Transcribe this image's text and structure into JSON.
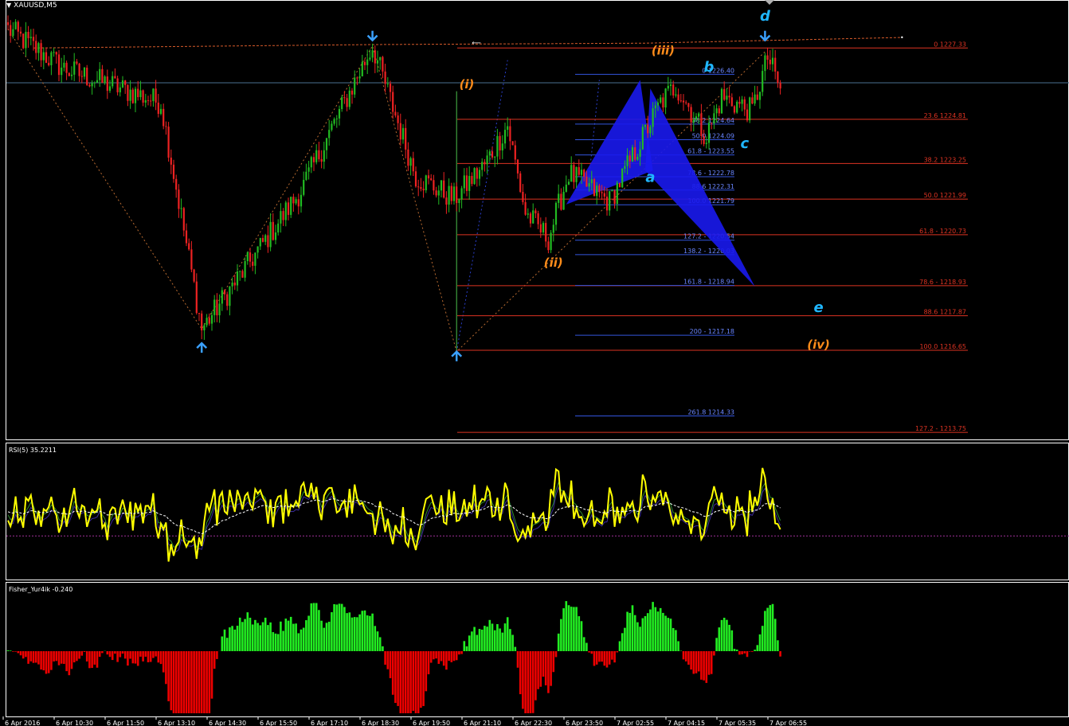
{
  "symbol": "XAUUSD,M5",
  "panels": {
    "rsi_label": "RSI(5) 35.2211",
    "fisher_label": "Fisher_Yur4ik -0.240"
  },
  "colors": {
    "background": "#000000",
    "bull": "#22bb22",
    "bear": "#ee2222",
    "fib_right": "#dd3322",
    "fib_left": "#3355dd",
    "pattern": "#1a1aee",
    "wave_orange": "#ff8c1a",
    "wave_cyan": "#1fb6ff",
    "arrow": "#3aa0ff",
    "rsi_line": "#ffff00",
    "fisher_pos": "#22ee22",
    "fisher_neg": "#ee0000"
  },
  "chart_data": [
    {
      "type": "candlestick",
      "title": "XAUUSD,M5",
      "ylim": [
        1213.5,
        1228.8
      ],
      "current_price_line": 1226.1,
      "x_tick_labels": [
        "6 Apr 2016",
        "6 Apr 10:30",
        "6 Apr 11:50",
        "6 Apr 13:10",
        "6 Apr 14:30",
        "6 Apr 15:50",
        "6 Apr 17:10",
        "6 Apr 18:30",
        "6 Apr 19:50",
        "6 Apr 21:10",
        "6 Apr 22:30",
        "6 Apr 23:50",
        "7 Apr 02:55",
        "7 Apr 04:15",
        "7 Apr 05:35",
        "7 Apr 06:55"
      ],
      "price_path_keypoints": [
        {
          "bar": 0,
          "price": 1228.0
        },
        {
          "bar": 22,
          "price": 1226.6
        },
        {
          "bar": 60,
          "price": 1225.4
        },
        {
          "bar": 76,
          "price": 1217.4
        },
        {
          "bar": 115,
          "price": 1222.3
        },
        {
          "bar": 143,
          "price": 1227.4
        },
        {
          "bar": 160,
          "price": 1222.8
        },
        {
          "bar": 175,
          "price": 1222.0
        },
        {
          "bar": 187,
          "price": 1223.2
        },
        {
          "bar": 196,
          "price": 1224.6
        },
        {
          "bar": 203,
          "price": 1221.5
        },
        {
          "bar": 212,
          "price": 1220.6
        },
        {
          "bar": 220,
          "price": 1222.9
        },
        {
          "bar": 236,
          "price": 1221.9
        },
        {
          "bar": 256,
          "price": 1225.4
        },
        {
          "bar": 262,
          "price": 1226.0
        },
        {
          "bar": 274,
          "price": 1224.2
        },
        {
          "bar": 280,
          "price": 1225.6
        },
        {
          "bar": 292,
          "price": 1225.1
        },
        {
          "bar": 298,
          "price": 1227.0
        },
        {
          "bar": 303,
          "price": 1225.9
        }
      ],
      "fib_retracement_right": [
        {
          "label": "0 1227.33",
          "price": 1227.33
        },
        {
          "label": "23.6 1224.81",
          "price": 1224.81
        },
        {
          "label": "38.2 1223.25",
          "price": 1223.25
        },
        {
          "label": "50.0 1221.99",
          "price": 1221.99
        },
        {
          "label": "61.8 - 1220.73",
          "price": 1220.73
        },
        {
          "label": "78.6 - 1218.93",
          "price": 1218.93
        },
        {
          "label": "88.6 1217.87",
          "price": 1217.87
        },
        {
          "label": "100.0 1216.65",
          "price": 1216.65
        },
        {
          "label": "127.2 - 1213.75",
          "price": 1213.75
        }
      ],
      "fib_levels_left": [
        {
          "label": "0 1226.40",
          "price": 1226.4
        },
        {
          "label": "38.2 1224.64",
          "price": 1224.64
        },
        {
          "label": "50.0 1224.09",
          "price": 1224.09
        },
        {
          "label": "61.8 - 1223.55",
          "price": 1223.55
        },
        {
          "label": "78.6 - 1222.78",
          "price": 1222.78
        },
        {
          "label": "88.6 1222.31",
          "price": 1222.31
        },
        {
          "label": "100.0 1221.79",
          "price": 1221.79
        },
        {
          "label": "127.2 - 1220.54",
          "price": 1220.54
        },
        {
          "label": "138.2 - 1220.03",
          "price": 1220.03
        },
        {
          "label": "161.8 - 1218.94",
          "price": 1218.94
        },
        {
          "label": "200 - 1217.18",
          "price": 1217.18
        },
        {
          "label": "261.8 1214.33",
          "price": 1214.33
        }
      ],
      "wave_labels": [
        {
          "text": "(i)",
          "color": "orange",
          "bar": 180,
          "price": 1225.9
        },
        {
          "text": "(ii)",
          "color": "orange",
          "bar": 214,
          "price": 1219.6
        },
        {
          "text": "(iii)",
          "color": "orange",
          "bar": 257,
          "price": 1227.1
        },
        {
          "text": "(iv)",
          "color": "orange",
          "bar": 318,
          "price": 1216.7
        },
        {
          "text": "a",
          "color": "cyan",
          "bar": 252,
          "price": 1222.6
        },
        {
          "text": "b",
          "color": "cyan",
          "bar": 275,
          "price": 1226.5
        },
        {
          "text": "c",
          "color": "cyan",
          "bar": 289,
          "price": 1223.8
        },
        {
          "text": "d",
          "color": "cyan",
          "bar": 297,
          "price": 1228.3
        },
        {
          "text": "e",
          "color": "cyan",
          "bar": 318,
          "price": 1218.0
        }
      ],
      "arrows": [
        {
          "dir": "down",
          "bar": 143,
          "price": 1227.6
        },
        {
          "dir": "up",
          "bar": 76,
          "price": 1216.9
        },
        {
          "dir": "up",
          "bar": 176,
          "price": 1216.6
        },
        {
          "dir": "down",
          "bar": 297,
          "price": 1227.6
        }
      ]
    },
    {
      "type": "line",
      "title": "RSI(5) 35.2211",
      "series": [
        {
          "name": "RSI(5)",
          "last_value": 35.2211
        }
      ],
      "ylim": [
        0,
        100
      ]
    },
    {
      "type": "bar",
      "title": "Fisher_Yur4ik -0.240",
      "series": [
        {
          "name": "Fisher_Yur4ik",
          "last_value": -0.24
        }
      ]
    }
  ]
}
